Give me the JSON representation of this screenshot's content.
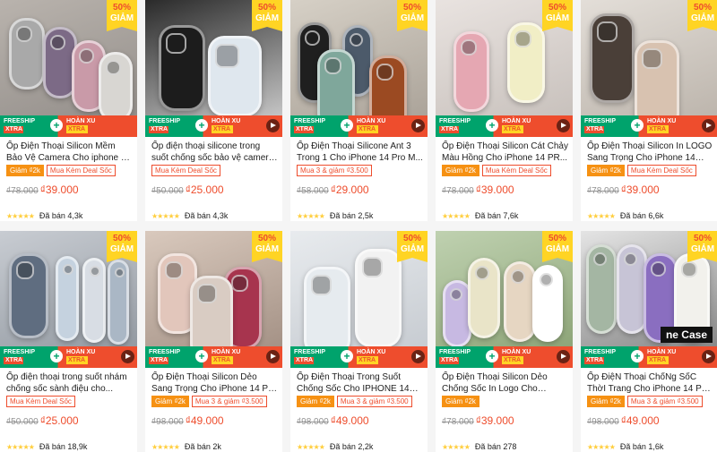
{
  "colors": {
    "accent": "#ee4d2d",
    "discount_badge": "#ffd424",
    "freeship": "#00a36c",
    "star": "#ffce3d"
  },
  "products": [
    {
      "discount_pct": "50%",
      "discount_label": "GIẢM",
      "title": "Ốp Điện Thoại Silicon Mềm Bảo Vệ Camera Cho iphone 14 pro...",
      "tags": [
        {
          "text": "Giảm ₫2k",
          "style": "fill"
        },
        {
          "text": "Mua Kèm Deal Sốc",
          "style": "outline"
        }
      ],
      "old_price": "₫78.000",
      "new_price": "₫39.000",
      "stars": "★★★★★",
      "sold": "Đã bán 4,3k",
      "promo_freeship": "FREESHIP",
      "promo_xtra": "XTRA",
      "promo_hoanxu": "HOÀN XU",
      "has_video": false
    },
    {
      "discount_pct": "50%",
      "discount_label": "GIẢM",
      "title": "Ốp điện thoại silicone trong suốt chống sốc bảo vệ camera cho...",
      "tags": [
        {
          "text": "Mua Kèm Deal Sốc",
          "style": "outline"
        }
      ],
      "old_price": "₫50.000",
      "new_price": "₫25.000",
      "stars": "★★★★★",
      "sold": "Đã bán 4,3k",
      "promo_freeship": "FREESHIP",
      "promo_xtra": "XTRA",
      "promo_hoanxu": "HOÀN XU",
      "has_video": true
    },
    {
      "discount_pct": "50%",
      "discount_label": "GIẢM",
      "title": "Ốp Điện Thoại Silicone Ant 3 Trong 1 Cho iPhone 14 Pro M...",
      "tags": [
        {
          "text": "Mua 3 & giảm ₫3.500",
          "style": "outline"
        }
      ],
      "old_price": "₫58.000",
      "new_price": "₫29.000",
      "stars": "★★★★★",
      "sold": "Đã bán 2,5k",
      "promo_freeship": "FREESHIP",
      "promo_xtra": "XTRA",
      "promo_hoanxu": "HOÀN XU",
      "has_video": true
    },
    {
      "discount_pct": "50%",
      "discount_label": "GIẢM",
      "title": "Ốp Điện Thoại Silicon Cát Chảy Màu Hồng Cho iPhone 14 PR...",
      "tags": [
        {
          "text": "Giảm ₫2k",
          "style": "fill"
        },
        {
          "text": "Mua Kèm Deal Sốc",
          "style": "outline"
        }
      ],
      "old_price": "₫78.000",
      "new_price": "₫39.000",
      "stars": "★★★★★",
      "sold": "Đã bán 7,6k",
      "promo_freeship": "FREESHIP",
      "promo_xtra": "XTRA",
      "promo_hoanxu": "HOÀN XU",
      "has_video": true
    },
    {
      "discount_pct": "50%",
      "discount_label": "GIẢM",
      "title": "Ốp Điện Thoại Silicon In LOGO Sang Trọng Cho iPhone 14 Pr...",
      "tags": [
        {
          "text": "Giảm ₫2k",
          "style": "fill"
        },
        {
          "text": "Mua Kèm Deal Sốc",
          "style": "outline"
        }
      ],
      "old_price": "₫78.000",
      "new_price": "₫39.000",
      "stars": "★★★★★",
      "sold": "Đã bán 6,6k",
      "promo_freeship": "FREESHIP",
      "promo_xtra": "XTRA",
      "promo_hoanxu": "HOÀN XU",
      "has_video": true
    },
    {
      "discount_pct": "50%",
      "discount_label": "GIẢM",
      "title": "Ốp điện thoại trong suốt nhám chống sốc sành điệu cho...",
      "tags": [
        {
          "text": "Mua Kèm Deal Sốc",
          "style": "outline"
        }
      ],
      "old_price": "₫50.000",
      "new_price": "₫25.000",
      "stars": "★★★★★",
      "sold": "Đã bán 18,9k",
      "promo_freeship": "FREESHIP",
      "promo_xtra": "XTRA",
      "promo_hoanxu": "HOÀN XU",
      "has_video": true
    },
    {
      "discount_pct": "50%",
      "discount_label": "GIẢM",
      "title": "Ốp Điện Thoại Silicon Dẻo Sang Trọng Cho iPhone 14 Pro Max...",
      "tags": [
        {
          "text": "Giảm ₫2k",
          "style": "fill"
        },
        {
          "text": "Mua 3 & giảm ₫3.500",
          "style": "outline"
        }
      ],
      "old_price": "₫98.000",
      "new_price": "₫49.000",
      "stars": "★★★★★",
      "sold": "Đã bán 2k",
      "promo_freeship": "FREESHIP",
      "promo_xtra": "XTRA",
      "promo_hoanxu": "HOÀN XU",
      "has_video": true
    },
    {
      "discount_pct": "50%",
      "discount_label": "GIẢM",
      "title": "Ốp Điện Thoại Trong Suốt Chống Sốc Cho IPHONE 14 p...",
      "tags": [
        {
          "text": "Giảm ₫2k",
          "style": "fill"
        },
        {
          "text": "Mua 3 & giảm ₫3.500",
          "style": "outline"
        }
      ],
      "old_price": "₫98.000",
      "new_price": "₫49.000",
      "stars": "★★★★★",
      "sold": "Đã bán 2,2k",
      "promo_freeship": "FREESHIP",
      "promo_xtra": "XTRA",
      "promo_hoanxu": "HOÀN XU",
      "has_video": true
    },
    {
      "discount_pct": "50%",
      "discount_label": "GIẢM",
      "title": "Ốp Điện Thoại Silicon Dẻo Chống Sốc In Logo Cho iPhon...",
      "tags": [
        {
          "text": "Giảm ₫2k",
          "style": "fill"
        }
      ],
      "old_price": "₫78.000",
      "new_price": "₫39.000",
      "stars": "★★★★★",
      "sold": "Đã bán 278",
      "promo_freeship": "FREESHIP",
      "promo_xtra": "XTRA",
      "promo_hoanxu": "HOÀN XU",
      "has_video": true
    },
    {
      "discount_pct": "50%",
      "discount_label": "GIẢM",
      "title": "Ốp ĐiệN Thoại ChốNg SốC ThờI Trang Cho iPhone 14 Pro Max...",
      "tags": [
        {
          "text": "Giảm ₫2k",
          "style": "fill"
        },
        {
          "text": "Mua 3 & giảm ₫3.500",
          "style": "outline"
        }
      ],
      "old_price": "₫98.000",
      "new_price": "₫49.000",
      "stars": "★★★★★",
      "sold": "Đã bán 1,6k",
      "promo_freeship": "FREESHIP",
      "promo_xtra": "XTRA",
      "promo_hoanxu": "HOÀN XU",
      "image_caption": "ne Case",
      "has_video": true
    }
  ]
}
